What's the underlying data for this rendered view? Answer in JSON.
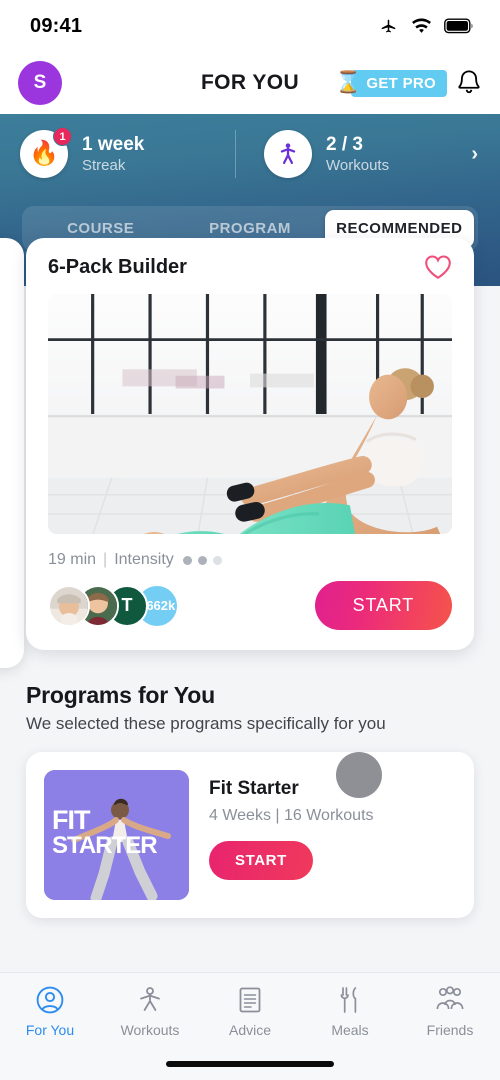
{
  "status_bar": {
    "time": "09:41",
    "icons": [
      "airplane-icon",
      "wifi-icon",
      "battery-icon"
    ]
  },
  "header": {
    "avatar_initial": "S",
    "avatar_color": "#9B36DE",
    "title": "FOR YOU",
    "pro_label": "GET PRO",
    "pro_color": "#62CBF2",
    "pro_icon": "hourglass-icon",
    "bell_icon": "bell-icon"
  },
  "banner": {
    "background_top": "#3C7E9B",
    "background_bottom": "#2B5480",
    "stats": [
      {
        "icon": "flame-icon",
        "badge": "1",
        "badge_color": "#E8275B",
        "value": "1 week",
        "label": "Streak"
      },
      {
        "icon": "runner-icon",
        "value": "2 / 3",
        "label": "Workouts"
      }
    ],
    "chevron_icon": "chevron-right-icon"
  },
  "tabs": {
    "items": [
      {
        "label": "COURSE",
        "active": false
      },
      {
        "label": "PROGRAM",
        "active": false
      },
      {
        "label": "RECOMMENDED",
        "active": true
      }
    ]
  },
  "workout_card": {
    "title": "6-Pack Builder",
    "favorite_icon": "heart-outline-icon",
    "favorite_color": "#EF4F7A",
    "duration": "19 min",
    "separator": "|",
    "intensity_label": "Intensity",
    "intensity_filled": 2,
    "intensity_total": 3,
    "avatars": [
      {
        "type": "photo",
        "name": "avatar-photo-1"
      },
      {
        "type": "photo",
        "name": "avatar-photo-2"
      },
      {
        "type": "initial",
        "initial": "T",
        "color": "#10593F"
      },
      {
        "type": "count",
        "count": "+662k",
        "color": "#74CDF2"
      }
    ],
    "start_label": "START",
    "start_gradient_from": "#E0218F",
    "start_gradient_to": "#F4544B"
  },
  "programs_section": {
    "title": "Programs for You",
    "subtitle": "We selected these programs specifically for you",
    "cards": [
      {
        "thumb_line1": "FIT",
        "thumb_line2": "STARTER",
        "thumb_color": "#8C80E6",
        "name": "Fit Starter",
        "meta": "4 Weeks | 16 Workouts",
        "start_label": "START"
      }
    ]
  },
  "bottom_nav": {
    "items": [
      {
        "label": "For You",
        "icon": "person-circle-icon",
        "active": true
      },
      {
        "label": "Workouts",
        "icon": "runner-icon",
        "active": false
      },
      {
        "label": "Advice",
        "icon": "document-icon",
        "active": false
      },
      {
        "label": "Meals",
        "icon": "cutlery-icon",
        "active": false
      },
      {
        "label": "Friends",
        "icon": "group-icon",
        "active": false
      }
    ],
    "active_color": "#2D8CF0",
    "inactive_color": "#8A8F99"
  }
}
